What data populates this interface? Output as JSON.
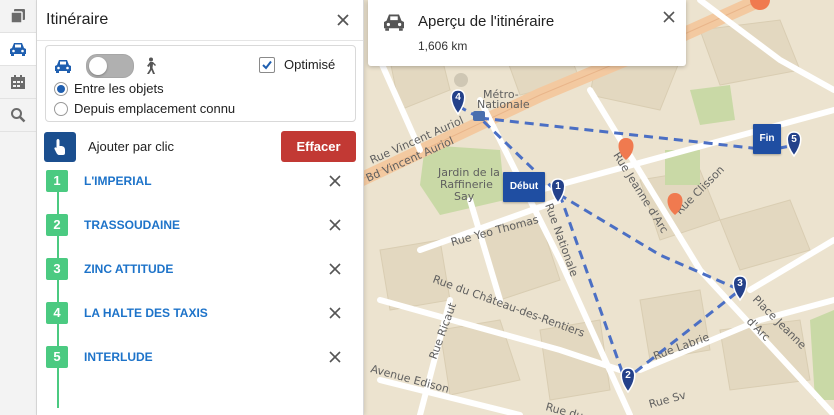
{
  "rail": {
    "items": [
      {
        "name": "layers-icon"
      },
      {
        "name": "car-icon"
      },
      {
        "name": "calendar-icon"
      },
      {
        "name": "search-icon"
      }
    ]
  },
  "panel": {
    "title": "Itinéraire",
    "optimized_label": "Optimisé",
    "optimized_checked": true,
    "radio_between": "Entre les objets",
    "radio_from": "Depuis emplacement connu",
    "add_by_click": "Ajouter par clic",
    "clear_label": "Effacer"
  },
  "stops": [
    {
      "num": "1",
      "name": "L'IMPERIAL"
    },
    {
      "num": "2",
      "name": "TRASSOUDAINE"
    },
    {
      "num": "3",
      "name": "ZINC ATTITUDE"
    },
    {
      "num": "4",
      "name": "LA HALTE DES TAXIS"
    },
    {
      "num": "5",
      "name": "INTERLUDE"
    }
  ],
  "route": {
    "title": "Aperçu de l'itinéraire",
    "distance": "1,606 km"
  },
  "map": {
    "start_tag": "Début",
    "end_tag": "Fin",
    "markers": [
      "1",
      "2",
      "3",
      "4",
      "5"
    ],
    "labels": {
      "metro": "Métro-",
      "nationale": "Nationale",
      "jardin1": "Jardin de la",
      "jardin2": "Raffinerie",
      "jardin3": "Say",
      "vincent1": "Rue Vincent Auriol",
      "vincent2": "Bd Vincent Auriol",
      "jeanne": "Rue Jeanne d'Arc",
      "clisson": "Rue Clisson",
      "yeo": "Rue Yeo Thomas",
      "nationale_rue": "Rue Nationale",
      "chateau": "Rue du Château-des-Rentiers",
      "ricaut": "Rue Ricaut",
      "edison": "Avenue Edison",
      "labrie": "Rue Labrie",
      "place1": "Place Jeanne",
      "place2": "d'Arc",
      "ruedu": "Rue du",
      "ruesv": "Rue Sv"
    }
  },
  "colors": {
    "accent_blue": "#1b4f8f",
    "stop_green": "#4bca81",
    "clear_red": "#c23934",
    "link_blue": "#1d73c9",
    "route_line": "#4b6fc4"
  }
}
